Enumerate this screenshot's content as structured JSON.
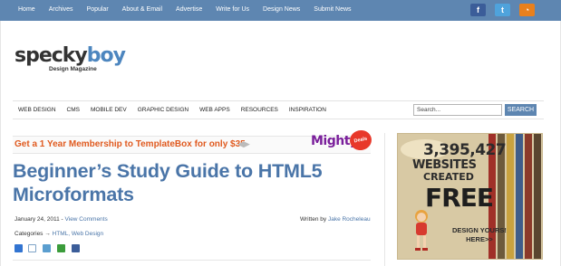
{
  "topnav": {
    "links": [
      "Home",
      "Archives",
      "Popular",
      "About & Email",
      "Advertise",
      "Write for Us",
      "Design News",
      "Submit News"
    ],
    "social": [
      {
        "name": "facebook",
        "glyph": "f"
      },
      {
        "name": "twitter",
        "glyph": "t"
      },
      {
        "name": "rss",
        "glyph": "◔"
      }
    ],
    "bg": "#5e86b1"
  },
  "logo": {
    "part1": "specky",
    "part2": "boy",
    "tagline": "Design Magazine"
  },
  "catnav": {
    "items": [
      "WEB DESIGN",
      "CMS",
      "MOBILE DEV",
      "GRAPHIC DESIGN",
      "WEB APPS",
      "RESOURCES",
      "INSPIRATION"
    ]
  },
  "search": {
    "value": "Search...",
    "button": "SEARCH"
  },
  "promo": {
    "text": "Get a 1 Year Membership to TemplateBox for only $35",
    "arrows": "◀▶",
    "brand": "Mighty",
    "badge": "Deals"
  },
  "article": {
    "title": "Beginner’s Study Guide to HTML5 Microformats",
    "date": "January 24, 2011",
    "date_sep": " - ",
    "comments_link": "View Comments",
    "written_by": "Written by ",
    "author": "Jake Rocheleau",
    "categories_label": "Categories → ",
    "categories": "HTML, Web Design",
    "share_icons": [
      "delicious",
      "digg",
      "stumbleupon",
      "technorati",
      "facebook"
    ]
  },
  "ad": {
    "count": "3,395,427",
    "line1": "WEBSITES",
    "line2": "CREATED",
    "line3": "FREE",
    "cta1": "DESIGN YOURS!",
    "cta2": "HERE>>"
  },
  "colors": {
    "accent": "#4a75a8",
    "promo": "#e05a1f",
    "brand": "#7a1f9b"
  }
}
